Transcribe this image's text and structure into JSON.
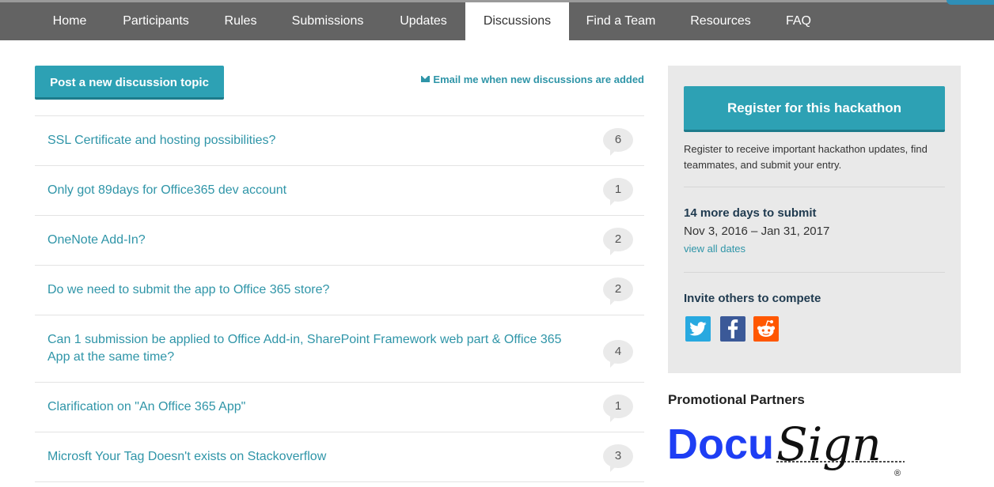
{
  "nav": {
    "items": [
      {
        "label": "Home"
      },
      {
        "label": "Participants"
      },
      {
        "label": "Rules"
      },
      {
        "label": "Submissions"
      },
      {
        "label": "Updates"
      },
      {
        "label": "Discussions",
        "active": true
      },
      {
        "label": "Find a Team"
      },
      {
        "label": "Resources"
      },
      {
        "label": "FAQ"
      }
    ]
  },
  "actions": {
    "post_label": "Post a new discussion topic",
    "email_label": "Email me when new discussions are added"
  },
  "discussions": [
    {
      "title": "SSL Certificate and hosting possibilities?",
      "count": "6"
    },
    {
      "title": "Only got 89days for Office365 dev account",
      "count": "1"
    },
    {
      "title": "OneNote Add-In?",
      "count": "2"
    },
    {
      "title": "Do we need to submit the app to Office 365 store?",
      "count": "2"
    },
    {
      "title": "Can 1 submission be applied to Office Add-in, SharePoint Framework web part & Office 365 App at the same time?",
      "count": "4"
    },
    {
      "title": "Clarification on \"An Office 365 App\"",
      "count": "1"
    },
    {
      "title": "Microsft Your Tag Doesn't exists on Stackoverflow",
      "count": "3"
    }
  ],
  "sidebar": {
    "register_label": "Register for this hackathon",
    "register_desc": "Register to receive important hackathon updates, find teammates, and submit your entry.",
    "days_title": "14 more days to submit",
    "dates": "Nov 3, 2016 – Jan 31, 2017",
    "view_dates": "view all dates",
    "invite_title": "Invite others to compete"
  },
  "promo": {
    "title": "Promotional Partners",
    "logo_text_1": "Docu",
    "logo_text_2": "Sign",
    "logo_mark": "®"
  },
  "colors": {
    "accent": "#2da1b4",
    "link": "#2f95a8",
    "nav_bg": "#636363",
    "docusign_blue": "#1e3ef4"
  }
}
